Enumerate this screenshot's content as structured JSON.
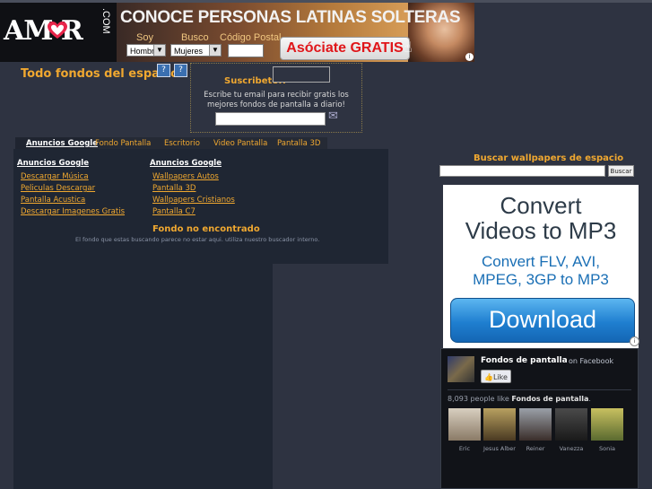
{
  "banner": {
    "logo": "AM R",
    "logo_suffix": ".COM",
    "headline": "CONOCE PERSONAS LATINAS SOLTERAS",
    "label_soy": "Soy",
    "label_busco": "Busco",
    "label_zip": "Código Postal",
    "soy_value": "Hombre",
    "busco_value": "Mujeres",
    "cta": "Asóciate GRATIS"
  },
  "header": {
    "title": "Todo fondos del espacio",
    "btn1": "?",
    "btn2": "?"
  },
  "subscribe": {
    "label": "Suscribete!!",
    "description": "Escribe tu email para recibir gratis los mejores fondos de pantalla a diario!"
  },
  "tabs": {
    "active": "Anuncios Google",
    "items": [
      "Fondo Pantalla",
      "Escritorio",
      "Video Pantalla",
      "Pantalla 3D"
    ]
  },
  "ads_left": {
    "heading": "Anuncios Google",
    "links": [
      "Descargar Música",
      "Peliculas Descargar",
      "Pantalla Acustica",
      "Descargar Imagenes Gratis"
    ]
  },
  "ads_right": {
    "heading": "Anuncios Google",
    "links": [
      "Wallpapers Autos",
      "Pantalla 3D",
      "Wallpapers Cristianos",
      "Pantalla C7"
    ]
  },
  "not_found": {
    "title": "Fondo no encontrado",
    "description": "El fondo que estas buscando parece no estar aqui. utiliza nuestro buscador interno."
  },
  "search": {
    "title": "Buscar wallpapers de espacio",
    "button": "Buscar"
  },
  "ad": {
    "line1": "Convert",
    "line2": "Videos to MP3",
    "line3": "Convert FLV, AVI,",
    "line4": "MPEG, 3GP to MP3",
    "button": "Download"
  },
  "facebook": {
    "page_name": "Fondos de pantalla",
    "on_text": "on Facebook",
    "like": "Like",
    "count_prefix": "8,093 people like ",
    "count_page": "Fondos de pantalla",
    "count_suffix": ".",
    "fans": [
      "Eric",
      "Jesus Alber",
      "Reiner",
      "Vanezza",
      "Sonia"
    ]
  }
}
